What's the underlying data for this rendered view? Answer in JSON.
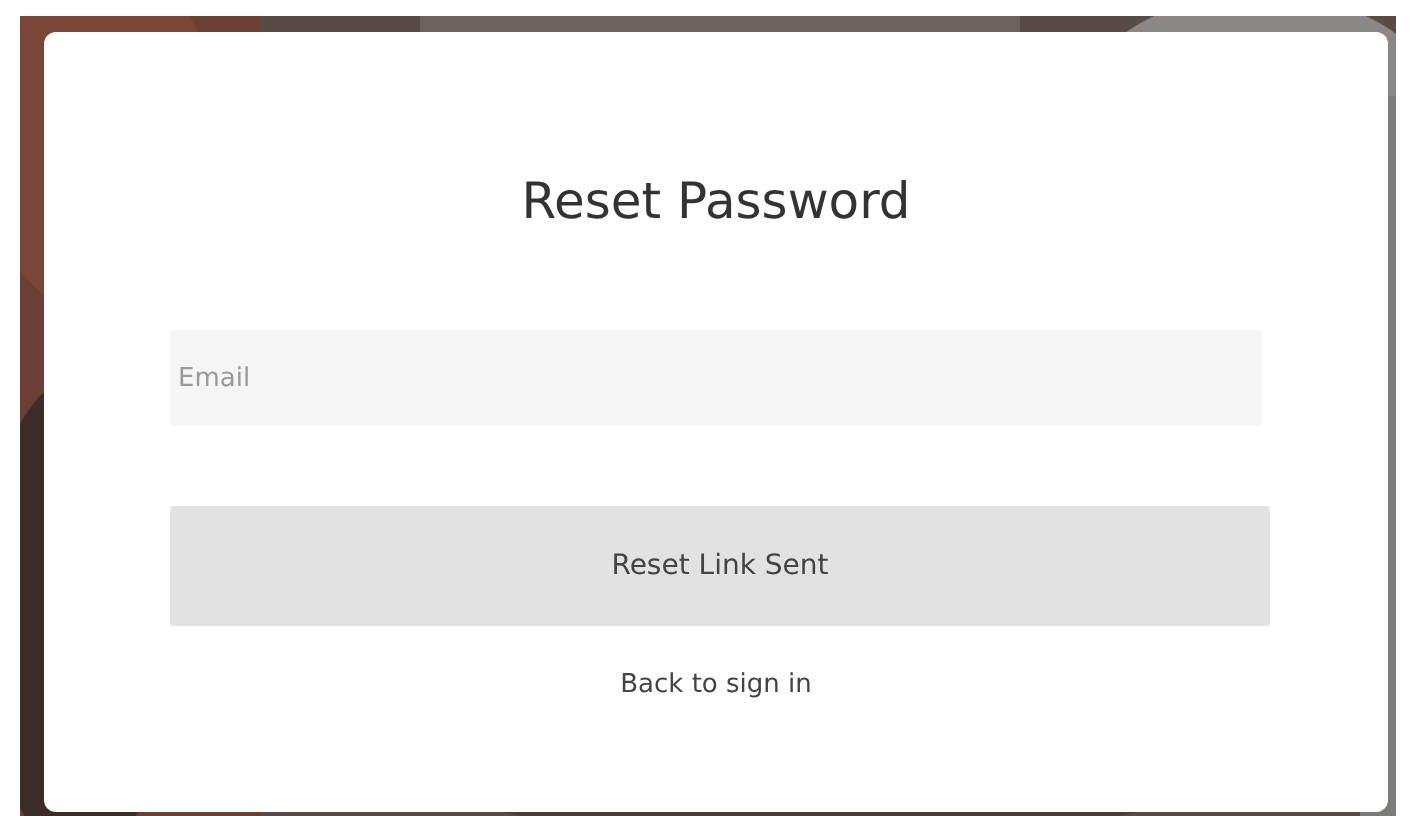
{
  "dialog": {
    "title": "Reset Password",
    "email_field": {
      "placeholder": "Email"
    },
    "submit_button": {
      "label": "Reset Link Sent",
      "disabled": true
    },
    "back_link": "Back to sign in"
  }
}
